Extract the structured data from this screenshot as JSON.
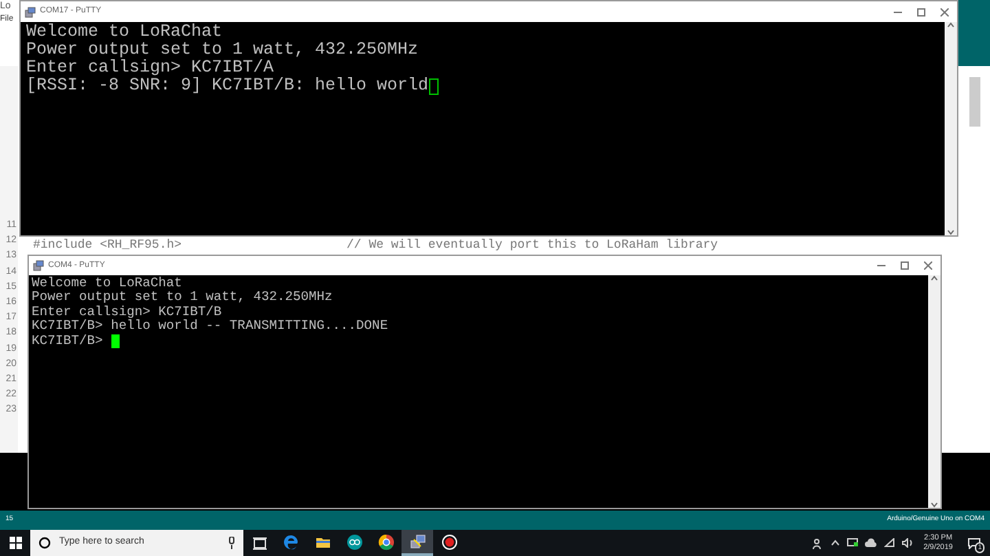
{
  "ide": {
    "title": "Lo",
    "menu": [
      "File"
    ],
    "line_numbers": [
      "11",
      "12",
      "13",
      "14",
      "15",
      "16",
      "17",
      "18",
      "19",
      "20",
      "21",
      "22",
      "23"
    ],
    "code_line": {
      "code": "#include <RH_RF95.h>",
      "comment": "// We will eventually port this to LoRaHam library"
    },
    "status_bar": {
      "line": "15",
      "board": "Arduino/Genuine Uno on COM4"
    }
  },
  "windows": [
    {
      "title": "COM17 - PuTTY",
      "focused": false,
      "lines": [
        "Welcome to LoRaChat",
        "Power output set to 1 watt, 432.250MHz",
        "Enter callsign> KC7IBT/A",
        "[RSSI: -8 SNR: 9] KC7IBT/B: hello world"
      ]
    },
    {
      "title": "COM4 - PuTTY",
      "focused": true,
      "lines": [
        "Welcome to LoRaChat",
        "Power output set to 1 watt, 432.250MHz",
        "Enter callsign> KC7IBT/B",
        "KC7IBT/B> hello world -- TRANSMITTING....DONE",
        "KC7IBT/B> "
      ]
    }
  ],
  "taskbar": {
    "search_placeholder": "Type here to search",
    "apps": [
      {
        "kind": "taskview",
        "selected": false
      },
      {
        "kind": "edge",
        "selected": false
      },
      {
        "kind": "explorer",
        "selected": false
      },
      {
        "kind": "arduino",
        "selected": false
      },
      {
        "kind": "chrome",
        "selected": false
      },
      {
        "kind": "putty",
        "selected": true
      },
      {
        "kind": "record",
        "selected": false
      }
    ],
    "time": "2:30 PM",
    "date": "2/9/2019",
    "notifications": "1"
  }
}
